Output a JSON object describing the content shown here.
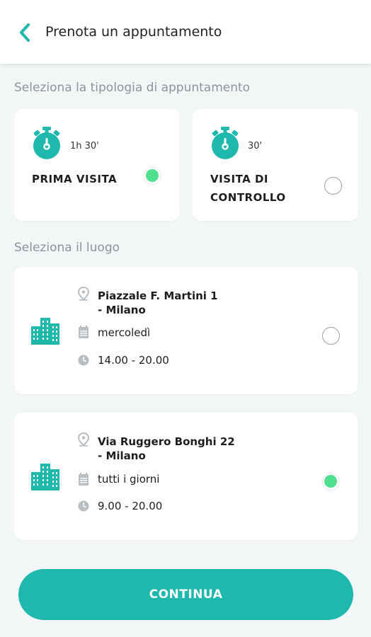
{
  "header": {
    "title": "Prenota un appuntamento"
  },
  "type_section": {
    "label": "Seleziona la tipologia di appuntamento",
    "options": [
      {
        "duration": "1h 30'",
        "label": "PRIMA VISITA",
        "selected": true
      },
      {
        "duration": "30'",
        "label_line1": "VISITA DI",
        "label_line2": "CONTROLLO",
        "selected": false
      }
    ]
  },
  "place_section": {
    "label": "Seleziona il luogo",
    "places": [
      {
        "address_line1": "Piazzale F. Martini 1",
        "address_line2": "- Milano",
        "days": "mercoledì",
        "hours": "14.00 - 20.00",
        "selected": false
      },
      {
        "address_line1": "Via Ruggero Bonghi 22",
        "address_line2": "- Milano",
        "days": "tutti i giorni",
        "hours": "9.00 - 20.00",
        "selected": true
      }
    ]
  },
  "colors": {
    "accent": "#1fb8ac",
    "selected_radio": "#4fe08f",
    "icon_gray": "#b9bec2",
    "background": "#f2f6f7"
  },
  "continue_button": {
    "label": "CONTINUA"
  }
}
